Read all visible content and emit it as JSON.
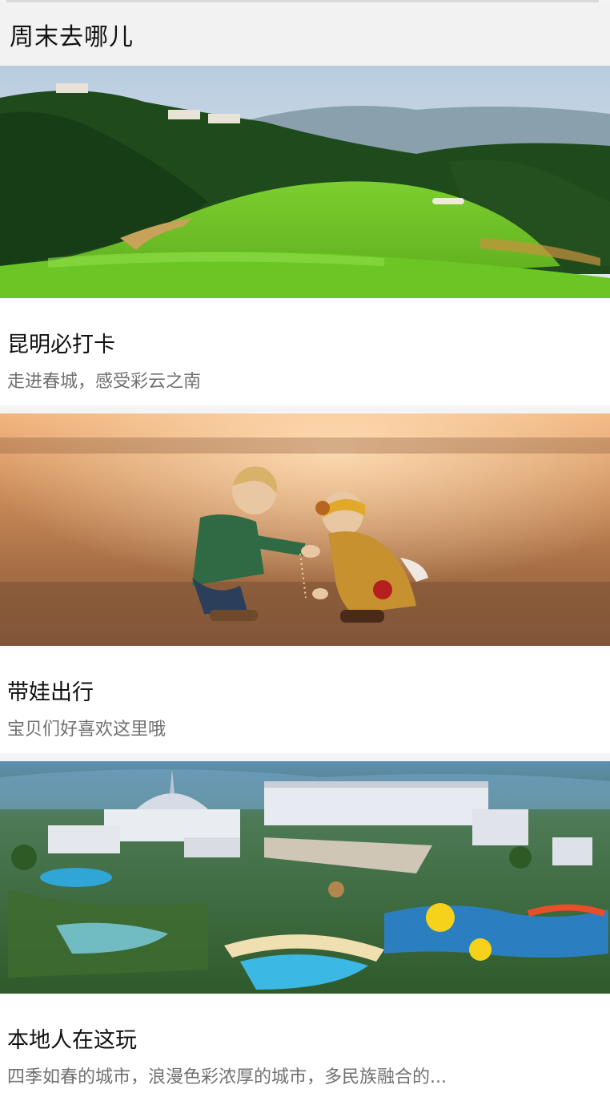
{
  "header": {
    "title": "周末去哪儿"
  },
  "cards": [
    {
      "title": "昆明必打卡",
      "subtitle": "走进春城，感受彩云之南",
      "image": "golf-course-landscape"
    },
    {
      "title": "带娃出行",
      "subtitle": "宝贝们好喜欢这里哦",
      "image": "two-toddlers-playing-in-sand"
    },
    {
      "title": "本地人在这玩",
      "subtitle": "四季如春的城市，浪漫色彩浓厚的城市，多民族融合的...",
      "image": "resort-waterpark-aerial"
    }
  ]
}
